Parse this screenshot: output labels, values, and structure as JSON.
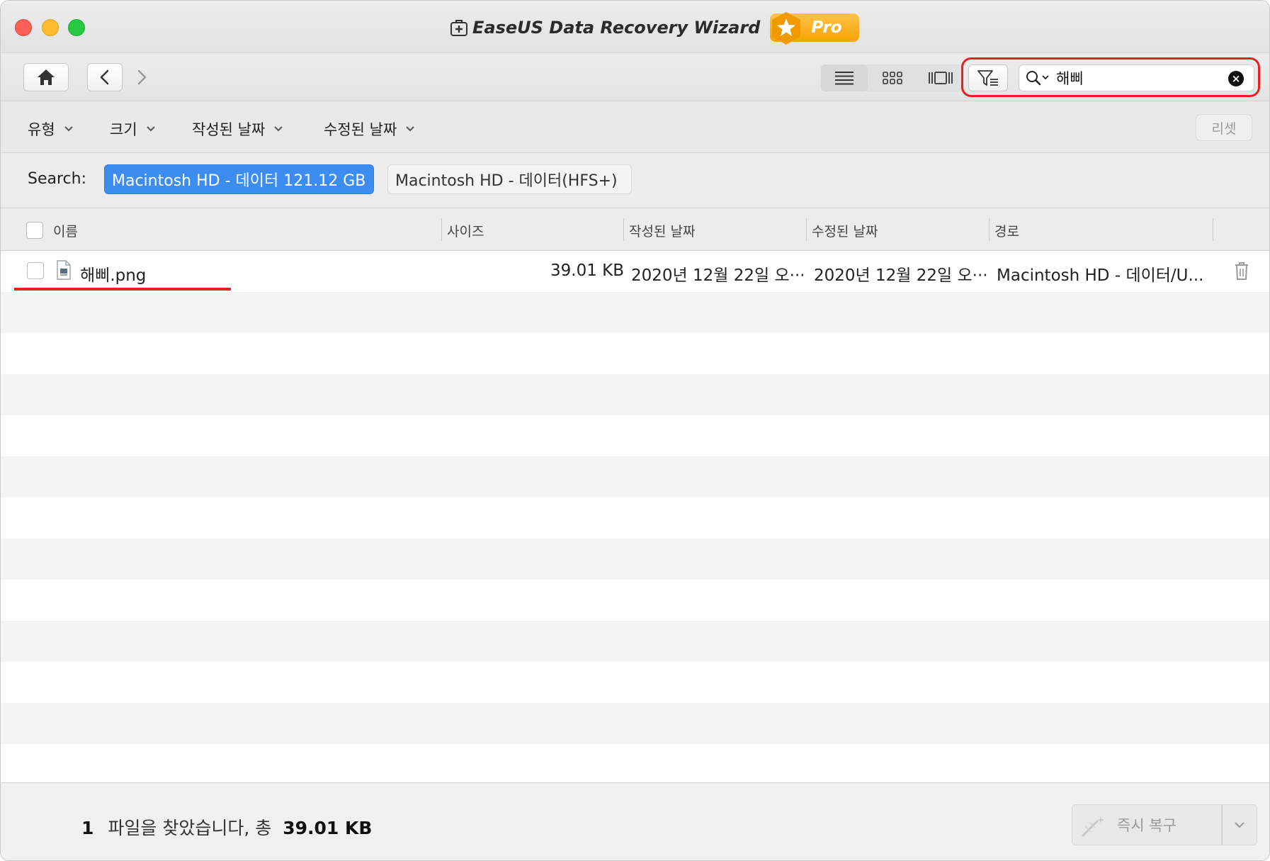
{
  "window": {
    "title": "EaseUS Data Recovery Wizard",
    "badge": "Pro"
  },
  "search": {
    "value": "해삐",
    "placeholder": ""
  },
  "filters": {
    "type_label": "유형",
    "size_label": "크기",
    "created_label": "작성된 날짜",
    "modified_label": "수정된 날짜",
    "reset_label": "리셋"
  },
  "scope": {
    "label": "Search:",
    "tabs": [
      {
        "label": "Macintosh HD - 데이터 121.12 GB",
        "active": true
      },
      {
        "label": "Macintosh HD - 데이터(HFS+)",
        "active": false
      }
    ]
  },
  "table": {
    "headers": {
      "name": "이름",
      "size": "사이즈",
      "created": "작성된 날짜",
      "modified": "수정된 날짜",
      "path": "경로"
    },
    "rows": [
      {
        "name": "해삐.png",
        "size": "39.01 KB",
        "created": "2020년 12월 22일 오···",
        "modified": "2020년 12월 22일 오···",
        "path": "Macintosh HD - 데이터/U..."
      }
    ]
  },
  "footer": {
    "count": "1",
    "text": "파일을 찾았습니다, 총",
    "total_size": "39.01 KB",
    "recover_label": "즉시 복구"
  },
  "colors": {
    "accent": "#3d8cf0",
    "highlight_red": "#e52222",
    "pro_orange": "#f5a300"
  }
}
